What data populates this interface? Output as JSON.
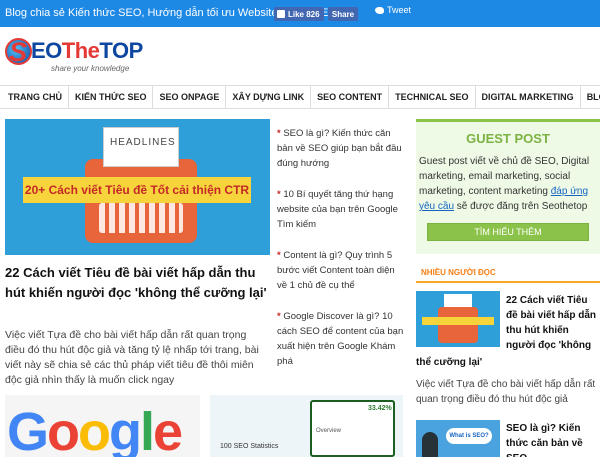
{
  "topbar": {
    "tagline": "Blog chia sẻ Kiến thức SEO, Hướng dẫn tối ưu Website chuẩn SEO",
    "fb_like": "Like 826",
    "fb_share": "Share",
    "tweet": "Tweet"
  },
  "logo": {
    "main_a": "EO",
    "main_b": "The",
    "main_c": "TOP",
    "s_letter": "S",
    "subtitle": "share your knowledge"
  },
  "nav": {
    "items": [
      "TRANG CHỦ",
      "KIẾN THỨC SEO",
      "SEO ONPAGE",
      "XÂY DỰNG LINK",
      "SEO CONTENT",
      "TECHNICAL SEO",
      "DIGITAL MARKETING",
      "BLOG"
    ]
  },
  "featured": {
    "image_paper": "HEADLINES",
    "image_banner": "20+ Cách viết Tiêu đề Tốt cải thiện CTR",
    "title": "22 Cách viết Tiêu đề bài viết hấp dẫn thu hút khiến người đọc 'không thể cưỡng lại'",
    "excerpt": "Việc viết Tựa đề cho bài viết hấp dẫn rất quan trọng điều đó thu hút độc giả và tăng tỷ lệ nhấp tới trang, bài viết này sẽ chia sẻ các thủ pháp viết tiêu đề thôi miên độc giả nhìn thấy là muốn click ngay"
  },
  "middle_list": [
    "SEO là gì? Kiến thức căn bản về SEO giúp bạn bắt đầu đúng hướng",
    "10 Bí quyết tăng thứ hạng website của bạn trên Google Tìm kiếm",
    "Content là gì? Quy trình 5 bước viết Content toàn diện về 1 chủ đề cụ thể",
    "Google Discover là gì? 10 cách SEO để content của bạn xuất hiện trên Google Khám phá"
  ],
  "bottom_thumbs": {
    "google_text": "Google",
    "seo_stat_label": "100 SEO Statistics",
    "seo_stat_value": "33.42%",
    "seo_overview": "Overview"
  },
  "sidebar": {
    "guest": {
      "title": "GUEST POST",
      "text_before": "Guest post viết về chủ đề SEO, Digital marketing, email marketing, social marketing, content marketing ",
      "link": "đáp ứng yêu cầu",
      "text_after": " sẽ được đăng trên Seothetop",
      "button": "TÌM HIỂU THÊM"
    },
    "popular_heading": "NHIỀU NGƯỜI ĐỌC",
    "popular": [
      {
        "title_a": "22 Cách viết Tiêu đề bài viết hấp dẫn thu hút khiến người đọc 'không",
        "title_b": "thể cưỡng lại'",
        "excerpt": "Việc viết Tựa đề cho bài viết hấp dẫn rất quan trọng điều đó thu hút độc giả"
      },
      {
        "title": "SEO là gì? Kiến thức căn bản về SEO",
        "image_text": "What is SEO?"
      }
    ]
  }
}
